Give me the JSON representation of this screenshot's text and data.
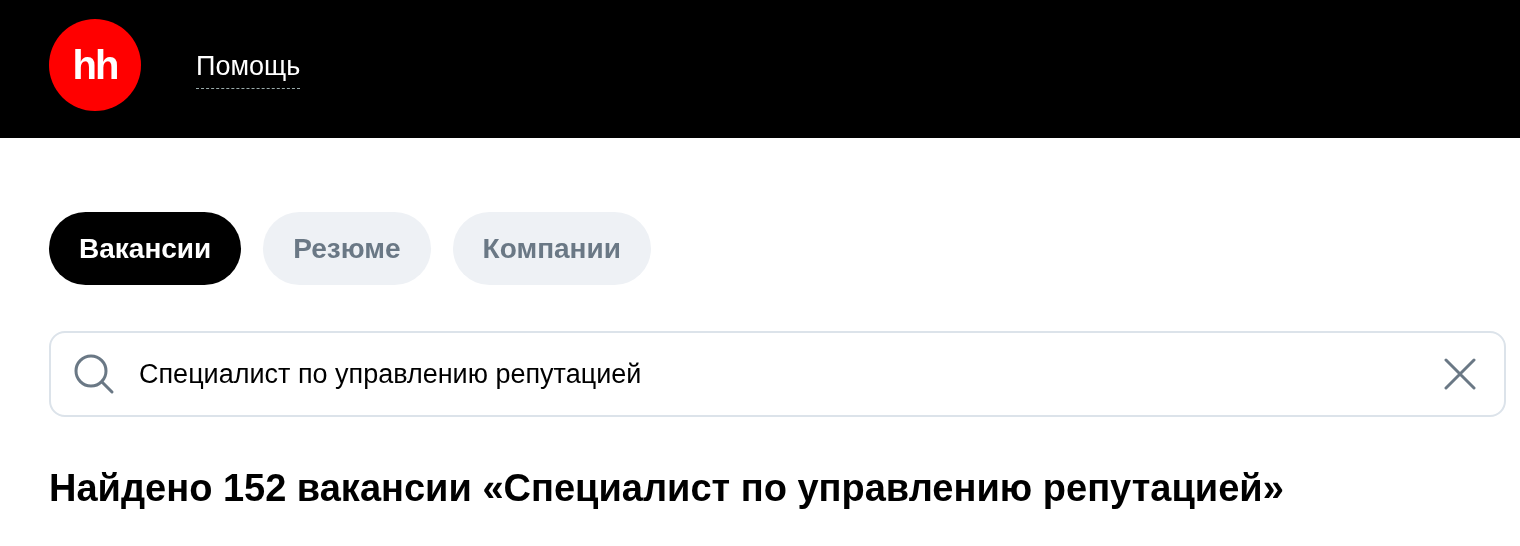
{
  "header": {
    "logo": "hh",
    "help_link": "Помощь"
  },
  "tabs": [
    {
      "label": "Вакансии",
      "selected": true
    },
    {
      "label": "Резюме",
      "selected": false
    },
    {
      "label": "Компании",
      "selected": false
    }
  ],
  "search": {
    "value": "Специалист по управлению репутацией"
  },
  "results_heading": "Найдено 152 вакансии «Специалист по управлению репутацией»"
}
